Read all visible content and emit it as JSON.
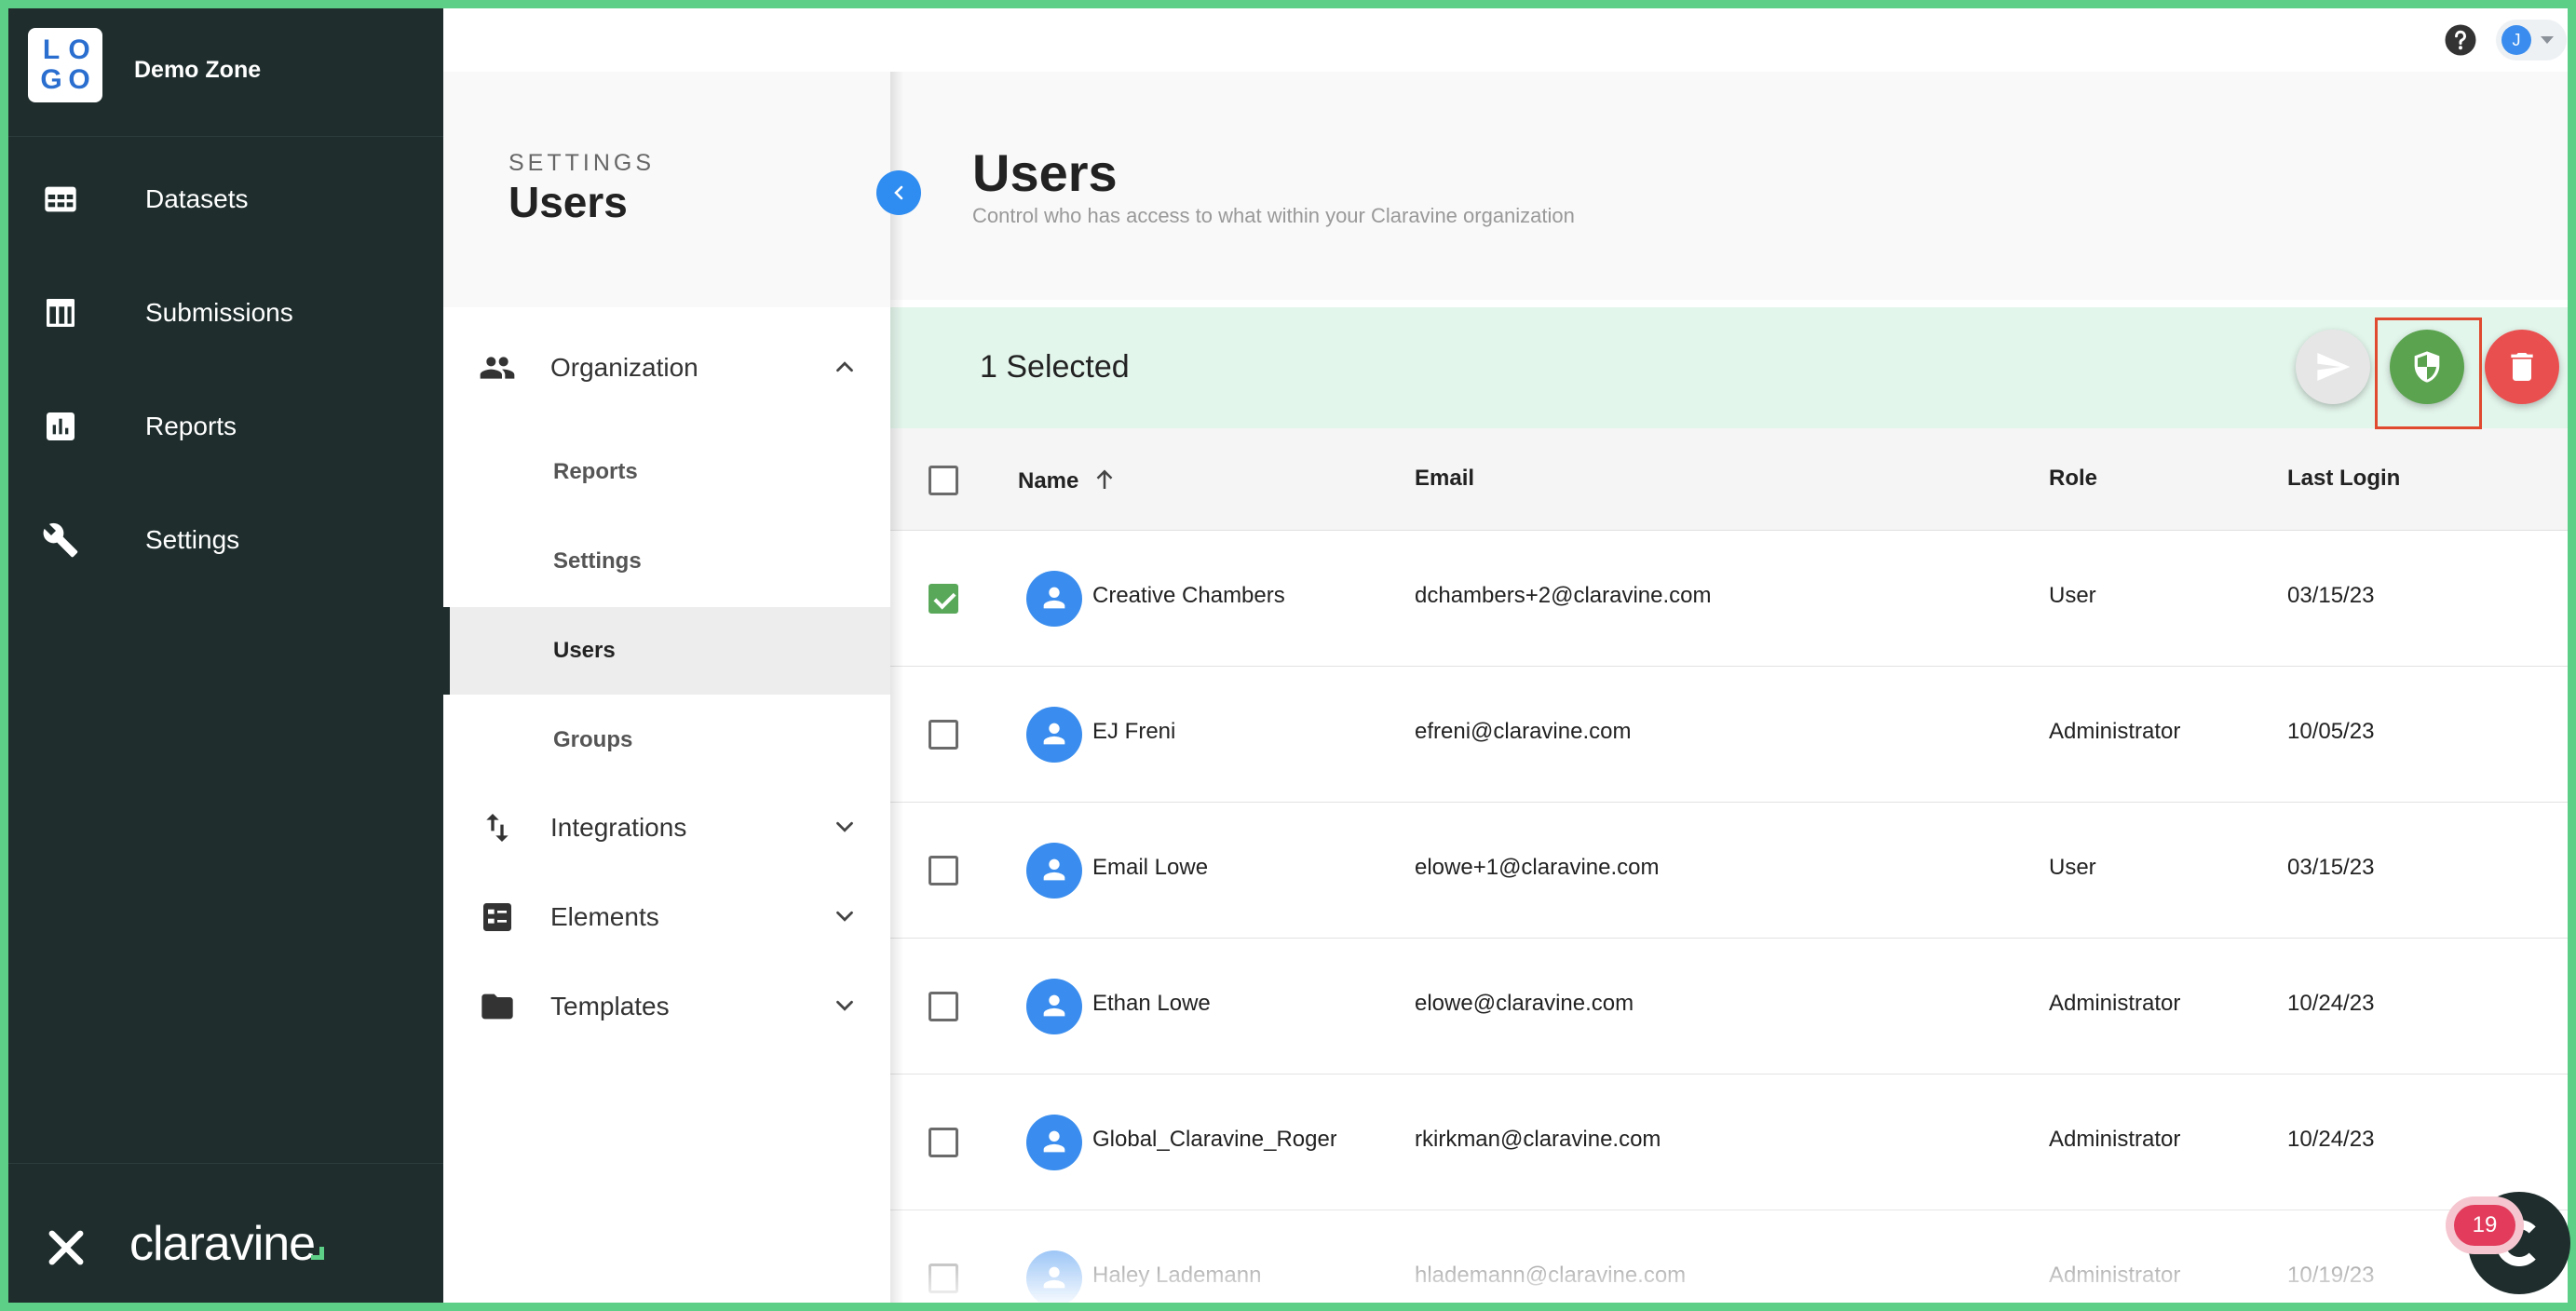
{
  "brand": {
    "logo_letters": [
      "L",
      "O",
      "G",
      "O"
    ],
    "workspace_name": "Demo Zone",
    "wordmark": "claravine"
  },
  "sidebar": {
    "items": [
      {
        "label": "Datasets",
        "icon": "table-grid-icon"
      },
      {
        "label": "Submissions",
        "icon": "layout-table-icon"
      },
      {
        "label": "Reports",
        "icon": "bar-chart-icon"
      },
      {
        "label": "Settings",
        "icon": "wrench-icon"
      }
    ]
  },
  "topbar": {
    "user_initial": "J"
  },
  "settings_panel": {
    "kicker": "SETTINGS",
    "title": "Users",
    "groups": [
      {
        "label": "Organization",
        "icon": "people-icon",
        "expanded": true,
        "children": [
          "Reports",
          "Settings",
          "Users",
          "Groups"
        ],
        "active_child": "Users"
      },
      {
        "label": "Integrations",
        "icon": "swap-vertical-icon",
        "expanded": false
      },
      {
        "label": "Elements",
        "icon": "checklist-icon",
        "expanded": false
      },
      {
        "label": "Templates",
        "icon": "folder-icon",
        "expanded": false
      }
    ]
  },
  "main": {
    "title": "Users",
    "subtitle": "Control who has access to what within your Claravine organization",
    "selection_text": "1 Selected",
    "columns": {
      "name": "Name",
      "email": "Email",
      "role": "Role",
      "last_login": "Last Login"
    },
    "sort": {
      "column": "name",
      "direction": "ascending"
    },
    "rows": [
      {
        "name": "Creative Chambers",
        "email": "dchambers+2@claravine.com",
        "role": "User",
        "last_login": "03/15/23",
        "checked": true
      },
      {
        "name": "EJ Freni",
        "email": "efreni@claravine.com",
        "role": "Administrator",
        "last_login": "10/05/23",
        "checked": false
      },
      {
        "name": "Email Lowe",
        "email": "elowe+1@claravine.com",
        "role": "User",
        "last_login": "03/15/23",
        "checked": false
      },
      {
        "name": "Ethan Lowe",
        "email": "elowe@claravine.com",
        "role": "Administrator",
        "last_login": "10/24/23",
        "checked": false
      },
      {
        "name": "Global_Claravine_Roger Kirkman",
        "email": "rkirkman@claravine.com",
        "role": "Administrator",
        "last_login": "10/24/23",
        "checked": false
      },
      {
        "name": "Haley Lademann",
        "email": "hlademann@claravine.com",
        "role": "Administrator",
        "last_login": "10/19/23",
        "checked": false
      }
    ]
  },
  "chat": {
    "badge_count": "19"
  },
  "colors": {
    "sidebar_bg": "#1f2d2d",
    "accent_blue": "#2f8cf0",
    "selection_bg": "#e3f6ec",
    "role_button": "#5ba34f",
    "delete_button": "#ea4f4f",
    "frame_green": "#5ecf86",
    "highlight": "#e04a2e"
  }
}
